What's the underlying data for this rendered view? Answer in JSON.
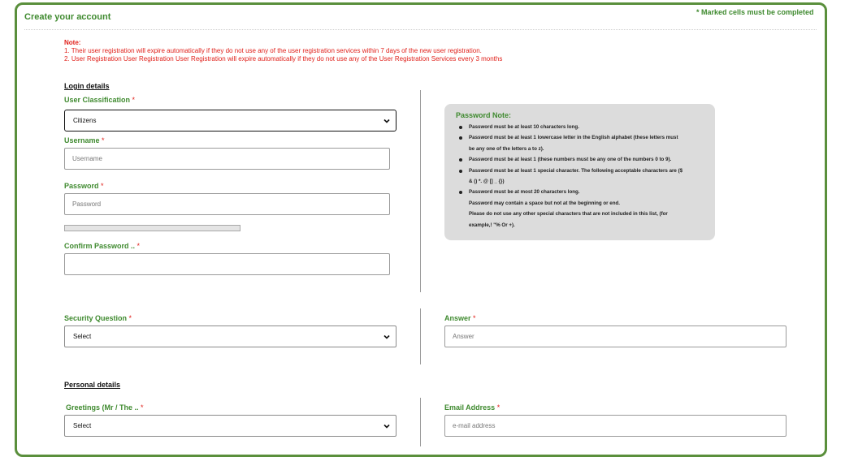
{
  "header": {
    "title": "Create your account",
    "marked_note": "* Marked cells must be completed"
  },
  "note": {
    "title": "Note:",
    "lines": [
      "1. Their user registration will expire automatically if they do not use any of the user registration services within 7 days of the new user registration.",
      "2. User Registration User Registration User Registration will expire automatically if they do not use any of the User Registration Services every 3 months"
    ]
  },
  "login": {
    "section_title": "Login details",
    "classification": {
      "label": "User Classification",
      "required": "*",
      "value": "Citizens"
    },
    "username": {
      "label": "Username",
      "required": "*",
      "placeholder": "Username",
      "value": ""
    },
    "password": {
      "label": "Password",
      "required": "*",
      "placeholder": "Password",
      "value": "",
      "strength_percent": 0
    },
    "confirm_password": {
      "label": "Confirm Password ..",
      "required": "*",
      "placeholder": "",
      "value": ""
    }
  },
  "password_note": {
    "title": "Password Note:",
    "items": [
      {
        "text": "Password must be at least 10 characters long.",
        "bullet": true
      },
      {
        "text": "Password must be at least 1 lowercase letter in the English alphabet (these letters must",
        "bullet": true
      },
      {
        "text": "be any one of the letters a to z).",
        "bullet": false
      },
      {
        "text": "Password must be at least 1 (these numbers must be any one of the numbers 0 to 9).",
        "bullet": true
      },
      {
        "text": "Password must be at least 1 special character. The following acceptable characters are ($",
        "bullet": true
      },
      {
        "text": "& () *. @ [] _ {})",
        "bullet": false
      },
      {
        "text": "Password must be at most 20 characters long.",
        "bullet": true
      },
      {
        "text": "Password may contain a space but not at the beginning or end.",
        "bullet": false
      },
      {
        "text": "Please do not use any other special characters that are not included in this list, (for",
        "bullet": false
      },
      {
        "text": "example,! \"% Or +).",
        "bullet": false
      }
    ]
  },
  "security": {
    "question": {
      "label": "Security Question",
      "required": "*",
      "value": "Select"
    },
    "answer": {
      "label": "Answer",
      "required": "*",
      "placeholder": "Answer",
      "value": ""
    }
  },
  "personal": {
    "section_title": "Personal details",
    "greetings": {
      "label": "Greetings (Mr / The ..",
      "required": "*",
      "value": "Select"
    },
    "email": {
      "label": "Email Address",
      "required": "*",
      "placeholder": "e-mail address",
      "value": ""
    }
  },
  "colors": {
    "accent_green": "#3f8a2f",
    "border_green": "#5a8f3c",
    "error_red": "#e0201a",
    "note_bg": "#dcdcdc"
  }
}
